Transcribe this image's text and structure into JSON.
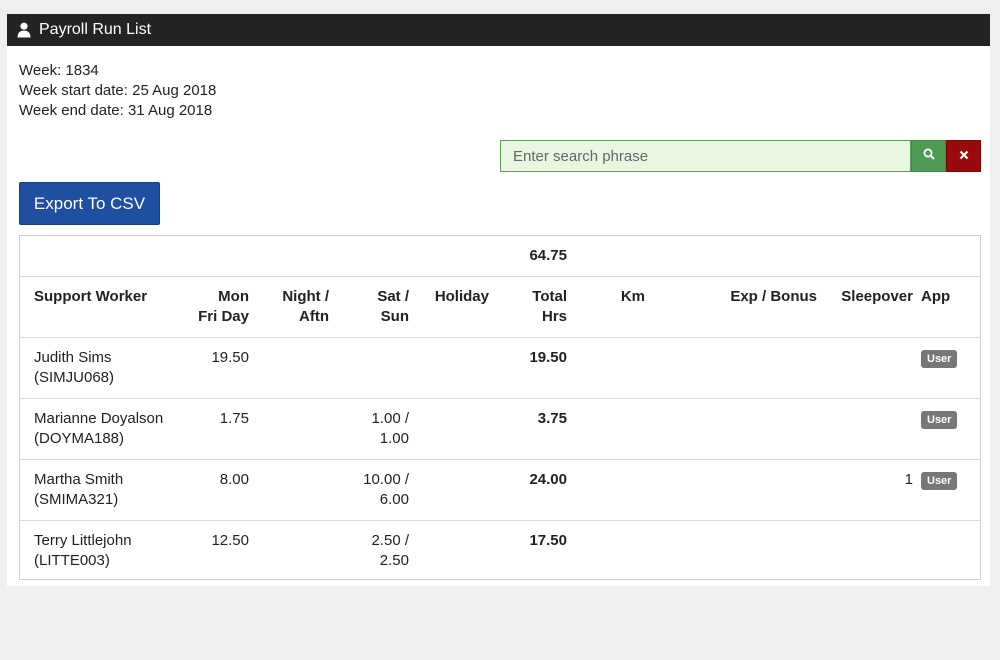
{
  "header": {
    "title": "Payroll Run List",
    "icon": "user-icon"
  },
  "info": {
    "week": "Week: 1834",
    "start": "Week start date: 25 Aug 2018",
    "end": "Week end date: 31 Aug 2018"
  },
  "search": {
    "placeholder": "Enter search phrase",
    "value": ""
  },
  "export_label": "Export To CSV",
  "table": {
    "grand_total": "64.75",
    "headers": {
      "worker": "Support Worker",
      "mon_line1": "Mon",
      "mon_line2": "Fri Day",
      "night_line1": "Night /",
      "night_line2": "Aftn",
      "sat_line1": "Sat /",
      "sat_line2": "Sun",
      "holiday": "Holiday",
      "total_line1": "Total",
      "total_line2": "Hrs",
      "km": "Km",
      "exp": "Exp / Bonus",
      "sleepover": "Sleepover",
      "app": "App"
    },
    "rows": [
      {
        "name": "Judith Sims",
        "code": "(SIMJU068)",
        "mon": "19.50",
        "night": "",
        "sat1": "",
        "sat2": "",
        "holiday": "",
        "total": "19.50",
        "km": "",
        "exp": "",
        "sleepover": "",
        "app": "User"
      },
      {
        "name": "Marianne Doyalson",
        "code": "(DOYMA188)",
        "mon": "1.75",
        "night": "",
        "sat1": "1.00 /",
        "sat2": "1.00",
        "holiday": "",
        "total": "3.75",
        "km": "",
        "exp": "",
        "sleepover": "",
        "app": "User"
      },
      {
        "name": "Martha Smith",
        "code": "(SMIMA321)",
        "mon": "8.00",
        "night": "",
        "sat1": "10.00 /",
        "sat2": "6.00",
        "holiday": "",
        "total": "24.00",
        "km": "",
        "exp": "",
        "sleepover": "1",
        "app": "User"
      },
      {
        "name": "Terry Littlejohn",
        "code": "(LITTE003)",
        "mon": "12.50",
        "night": "",
        "sat1": "2.50 /",
        "sat2": "2.50",
        "holiday": "",
        "total": "17.50",
        "km": "",
        "exp": "",
        "sleepover": "",
        "app": ""
      }
    ]
  },
  "colors": {
    "header_bg": "#222325",
    "search_bg": "#e8f6e2",
    "search_btn": "#4f9a54",
    "clear_btn": "#9b0a0a",
    "export_btn": "#1f4fa0",
    "badge": "#777777"
  }
}
